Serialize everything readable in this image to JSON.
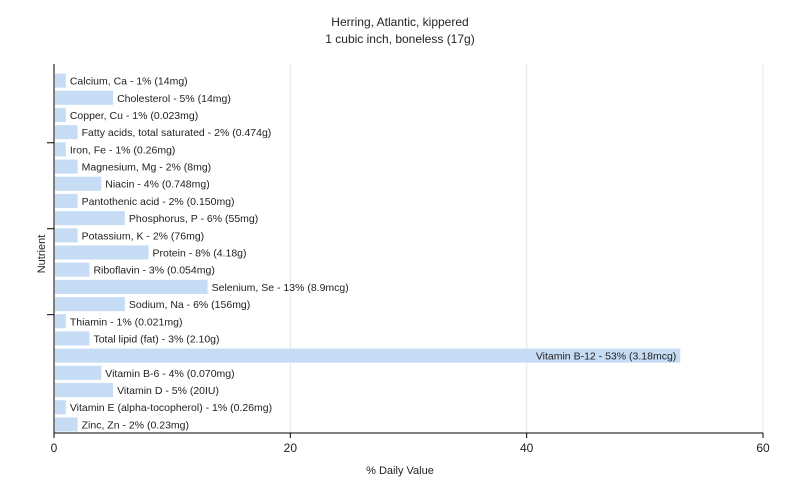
{
  "chart_data": {
    "type": "bar",
    "orientation": "horizontal",
    "title": "Herring, Atlantic, kippered",
    "subtitle": "1 cubic inch, boneless (17g)",
    "xlabel": "% Daily Value",
    "ylabel": "Nutrient",
    "xlim": [
      0,
      60
    ],
    "xticks": [
      "0",
      "20",
      "40",
      "60"
    ],
    "grid": "vertical",
    "legend": "none",
    "bar_color": "#c6dcf5",
    "categories": [
      "Calcium, Ca",
      "Cholesterol",
      "Copper, Cu",
      "Fatty acids, total saturated",
      "Iron, Fe",
      "Magnesium, Mg",
      "Niacin",
      "Pantothenic acid",
      "Phosphorus, P",
      "Potassium, K",
      "Protein",
      "Riboflavin",
      "Selenium, Se",
      "Sodium, Na",
      "Thiamin",
      "Total lipid (fat)",
      "Vitamin B-12",
      "Vitamin B-6",
      "Vitamin D",
      "Vitamin E (alpha-tocopherol)",
      "Zinc, Zn"
    ],
    "values": [
      1,
      5,
      1,
      2,
      1,
      2,
      4,
      2,
      6,
      2,
      8,
      3,
      13,
      6,
      1,
      3,
      53,
      4,
      5,
      1,
      2
    ],
    "labels": [
      "Calcium, Ca - 1% (14mg)",
      "Cholesterol - 5% (14mg)",
      "Copper, Cu - 1% (0.023mg)",
      "Fatty acids, total saturated - 2% (0.474g)",
      "Iron, Fe - 1% (0.26mg)",
      "Magnesium, Mg - 2% (8mg)",
      "Niacin - 4% (0.748mg)",
      "Pantothenic acid - 2% (0.150mg)",
      "Phosphorus, P - 6% (55mg)",
      "Potassium, K - 2% (76mg)",
      "Protein - 8% (4.18g)",
      "Riboflavin - 3% (0.054mg)",
      "Selenium, Se - 13% (8.9mcg)",
      "Sodium, Na - 6% (156mg)",
      "Thiamin - 1% (0.021mg)",
      "Total lipid (fat) - 3% (2.10g)",
      "Vitamin B-12 - 53% (3.18mcg)",
      "Vitamin B-6 - 4% (0.070mg)",
      "Vitamin D - 5% (20IU)",
      "Vitamin E (alpha-tocopherol) - 1% (0.26mg)",
      "Zinc, Zn - 2% (0.23mg)"
    ]
  }
}
